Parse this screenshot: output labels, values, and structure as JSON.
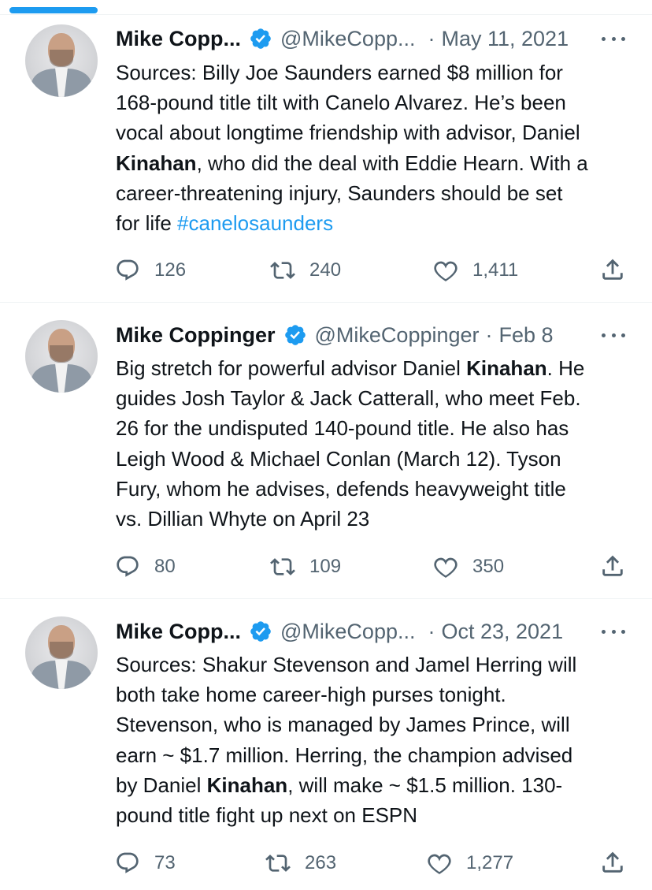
{
  "tweets": [
    {
      "name": "Mike Copp...",
      "handle": "@MikeCopp...",
      "separator": "·",
      "date": "May 11, 2021",
      "text_segments": [
        {
          "t": "Sources: Billy Joe Saunders earned $8 million for\n168-pound title tilt with Canelo Alvarez. He’s been\nvocal about longtime friendship with advisor, Daniel\n",
          "style": "normal"
        },
        {
          "t": "Kinahan",
          "style": "bold"
        },
        {
          "t": ", who did the deal with Eddie Hearn. With a\ncareer-threatening injury, Saunders should be set\nfor life ",
          "style": "normal"
        },
        {
          "t": "#canelosaunders",
          "style": "hashtag"
        }
      ],
      "replies": "126",
      "retweets": "240",
      "likes": "1,411"
    },
    {
      "name": "Mike Coppinger",
      "handle": "@MikeCoppinger",
      "separator": "·",
      "date": "Feb 8",
      "text_segments": [
        {
          "t": "Big stretch for powerful advisor Daniel ",
          "style": "normal"
        },
        {
          "t": "Kinahan",
          "style": "bold"
        },
        {
          "t": ". He\nguides Josh Taylor & Jack Catterall, who meet Feb.\n26 for the undisputed 140-pound title. He also has\nLeigh Wood & Michael Conlan (March 12). Tyson\nFury, whom he advises, defends heavyweight title\nvs. Dillian Whyte on April 23",
          "style": "normal"
        }
      ],
      "replies": "80",
      "retweets": "109",
      "likes": "350"
    },
    {
      "name": "Mike Copp...",
      "handle": "@MikeCopp...",
      "separator": "·",
      "date": "Oct 23, 2021",
      "text_segments": [
        {
          "t": "Sources: Shakur Stevenson and Jamel Herring will\nboth take home career-high purses tonight.\nStevenson, who is managed by James Prince, will\nearn ~ $1.7 million. Herring, the champion advised\nby Daniel ",
          "style": "normal"
        },
        {
          "t": "Kinahan",
          "style": "bold"
        },
        {
          "t": ", will make ~ $1.5 million. 130-\npound title fight up next on ESPN",
          "style": "normal"
        }
      ],
      "replies": "73",
      "retweets": "263",
      "likes": "1,277"
    }
  ],
  "icons": {
    "reply": "reply-icon",
    "retweet": "retweet-icon",
    "like": "heart-icon",
    "share": "share-icon",
    "more": "more-icon",
    "verified": "verified-badge-icon"
  },
  "colors": {
    "accent": "#1d9bf0",
    "text": "#0f1419",
    "secondary": "#536471",
    "divider": "#eff3f4"
  }
}
